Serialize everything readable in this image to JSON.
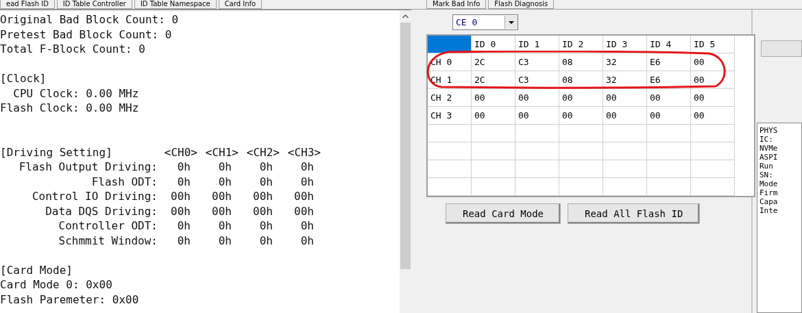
{
  "left_tabs": [
    {
      "label": "ead Flash ID",
      "selected": false
    },
    {
      "label": "ID Table Controller",
      "selected": false
    },
    {
      "label": "ID Table Namespace",
      "selected": false
    },
    {
      "label": "Card Info",
      "selected": false
    }
  ],
  "right_tabs": [
    {
      "label": "Mark Bad Info",
      "selected": false
    },
    {
      "label": "Flash Diagnosis",
      "selected": false
    }
  ],
  "log": {
    "blocks": [
      {
        "lines": [
          "Original Bad Block Count: 0",
          "Pretest Bad Block Count: 0",
          "Total F-Block Count: 0"
        ]
      },
      {
        "lines": [
          "[Clock]",
          "  CPU Clock: 0.00 MHz",
          "Flash Clock: 0.00 MHz"
        ]
      }
    ],
    "driving_setting": {
      "title": "[Driving Setting]",
      "channels": [
        "<CH0>",
        "<CH1>",
        "<CH2>",
        "<CH3>"
      ],
      "rows": [
        {
          "label": "Flash Output Driving:",
          "values": [
            "0h",
            "0h",
            "0h",
            "0h"
          ]
        },
        {
          "label": "Flash ODT:",
          "values": [
            "0h",
            "0h",
            "0h",
            "0h"
          ]
        },
        {
          "label": "Control IO Driving:",
          "values": [
            "00h",
            "00h",
            "00h",
            "00h"
          ]
        },
        {
          "label": "Data DQS Driving:",
          "values": [
            "00h",
            "00h",
            "00h",
            "00h"
          ]
        },
        {
          "label": "Controller ODT:",
          "values": [
            "0h",
            "0h",
            "0h",
            "0h"
          ]
        },
        {
          "label": "Schmmit Window:",
          "values": [
            "0h",
            "0h",
            "0h",
            "0h"
          ]
        }
      ]
    },
    "tail_lines": [
      "[Card Mode]",
      "Card Mode 0: 0x00",
      "Flash Paremeter: 0x00"
    ]
  },
  "ce_select": {
    "value": "CE 0"
  },
  "grid": {
    "corner_selected": true,
    "columns": [
      "ID 0",
      "ID 1",
      "ID 2",
      "ID 3",
      "ID 4",
      "ID 5"
    ],
    "rows": [
      {
        "label": "CH 0",
        "cells": [
          "2C",
          "C3",
          "08",
          "32",
          "E6",
          "00"
        ],
        "circled": true
      },
      {
        "label": "CH 1",
        "cells": [
          "2C",
          "C3",
          "08",
          "32",
          "E6",
          "00"
        ],
        "circled": true
      },
      {
        "label": "CH 2",
        "cells": [
          "00",
          "00",
          "00",
          "00",
          "00",
          "00"
        ],
        "circled": false
      },
      {
        "label": "CH 3",
        "cells": [
          "00",
          "00",
          "00",
          "00",
          "00",
          "00"
        ],
        "circled": false
      }
    ]
  },
  "buttons": [
    "Read Card Mode",
    "Read All Flash ID"
  ],
  "side_info": [
    "PHYS",
    "IC:",
    "NVMe",
    "ASPI",
    "Run",
    "SN:",
    "Mode",
    "Firm",
    "Capa",
    "Inte"
  ]
}
